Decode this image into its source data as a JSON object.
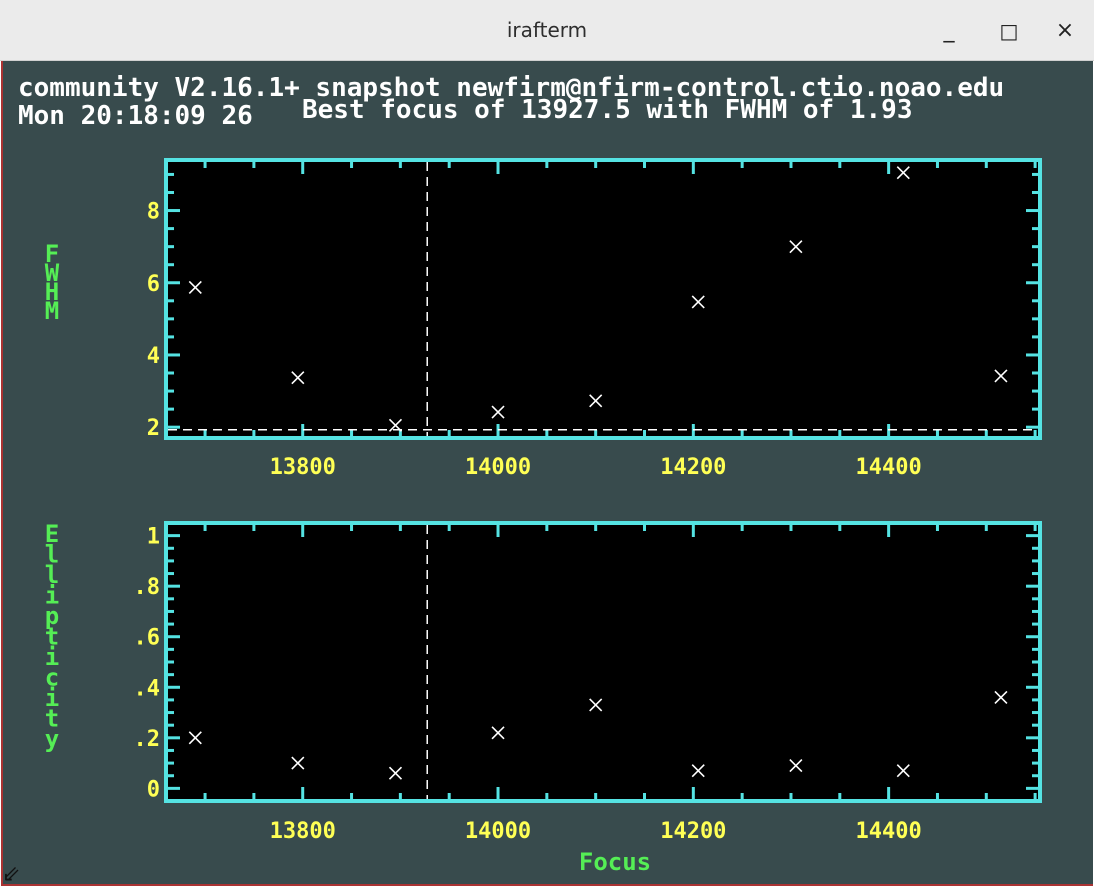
{
  "window": {
    "title": "irafterm",
    "minimize_label": "_",
    "maximize_label": "□",
    "close_label": "×"
  },
  "terminal": {
    "header_line1": "community V2.16.1+ snapshot newfirm@nfirm-control.ctio.noao.edu",
    "header_line2": "Mon 20:18:09 26",
    "plot_title": "Best focus of 13927.5 with FWHM of 1.93"
  },
  "colors": {
    "background": "#384b4d",
    "frame": "#55e3e3",
    "tick_labels": "#ffff55",
    "axis_titles": "#55ee55",
    "markers": "#ffffff"
  },
  "chart_data": [
    {
      "type": "scatter",
      "marker": "x",
      "xlabel": "",
      "ylabel": "FWHM",
      "xlim": [
        13660,
        14555
      ],
      "ylim": [
        1.7,
        9.4
      ],
      "x": [
        13690,
        13795,
        13895,
        14000,
        14100,
        14205,
        14305,
        14415,
        14515
      ],
      "y": [
        5.87,
        3.37,
        2.05,
        2.42,
        2.73,
        5.47,
        7.0,
        9.05,
        3.42
      ],
      "xticks": [
        13800,
        14000,
        14200,
        14400
      ],
      "xtick_labels": [
        "13800",
        "14000",
        "14200",
        "14400"
      ],
      "yticks": [
        2,
        4,
        6,
        8
      ],
      "ytick_labels": [
        "2",
        "4",
        "6",
        "8"
      ],
      "best_focus": 13927.5,
      "best_fwhm": 1.93
    },
    {
      "type": "scatter",
      "marker": "x",
      "xlabel": "Focus",
      "ylabel": "Ellipticity",
      "xlim": [
        13660,
        14555
      ],
      "ylim": [
        -0.05,
        1.05
      ],
      "x": [
        13690,
        13795,
        13895,
        14000,
        14100,
        14205,
        14305,
        14415,
        14515
      ],
      "y": [
        0.2,
        0.1,
        0.06,
        0.22,
        0.33,
        0.07,
        0.09,
        0.07,
        0.36
      ],
      "xticks": [
        13800,
        14000,
        14200,
        14400
      ],
      "xtick_labels": [
        "13800",
        "14000",
        "14200",
        "14400"
      ],
      "yticks": [
        0,
        0.2,
        0.4,
        0.6,
        0.8,
        1
      ],
      "ytick_labels": [
        "0",
        ".2",
        ".4",
        ".6",
        ".8",
        "1"
      ],
      "best_focus": 13927.5
    }
  ]
}
